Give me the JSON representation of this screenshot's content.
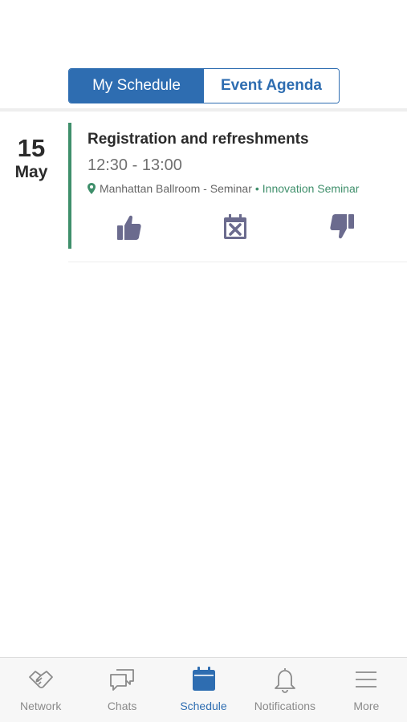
{
  "segmented_control": {
    "tabs": [
      {
        "label": "My Schedule",
        "active": true
      },
      {
        "label": "Event Agenda",
        "active": false
      }
    ]
  },
  "date": {
    "day": "15",
    "month": "May"
  },
  "event": {
    "title": "Registration and refreshments",
    "time": "12:30 - 13:00",
    "location": "Manhattan Ballroom - Seminar",
    "separator": "•",
    "track": "Innovation Seminar",
    "actions": [
      {
        "name": "thumbs-up-icon"
      },
      {
        "name": "calendar-remove-icon"
      },
      {
        "name": "thumbs-down-icon"
      }
    ]
  },
  "tabbar": {
    "items": [
      {
        "label": "Network",
        "icon": "handshake-icon",
        "active": false
      },
      {
        "label": "Chats",
        "icon": "chat-icon",
        "active": false
      },
      {
        "label": "Schedule",
        "icon": "calendar-icon",
        "active": true
      },
      {
        "label": "Notifications",
        "icon": "bell-icon",
        "active": false
      },
      {
        "label": "More",
        "icon": "menu-icon",
        "active": false
      }
    ]
  },
  "colors": {
    "primary": "#2e6db1",
    "accent_green": "#3f8f6b",
    "icon_purple": "#6b6b8e",
    "inactive_gray": "#8a8a8a"
  }
}
